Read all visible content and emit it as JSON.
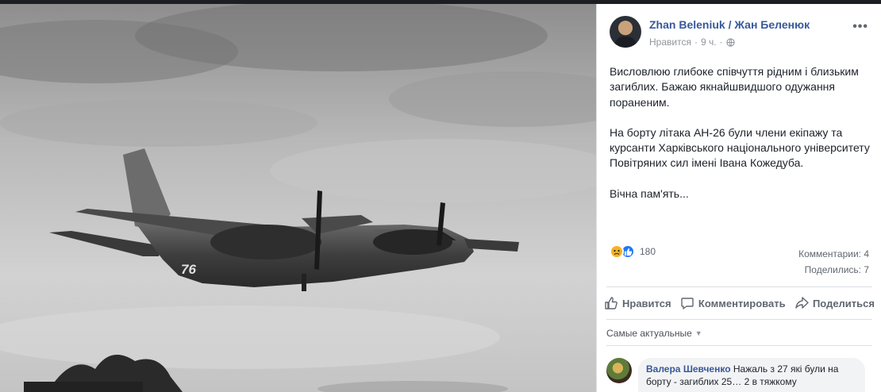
{
  "post": {
    "author": "Zhan Beleniuk / Жан Беленюк",
    "like_link": "Нравится",
    "separator": "·",
    "time": "9 ч.",
    "separator2": "·",
    "more": "•••",
    "paragraphs": [
      "Висловлюю глибоке співчуття рідним і близьким загиблих. Бажаю якнайшвидшого одужання пораненим.",
      "На борту літака АН-26 були члени екіпажу та курсанти Харківського національного університету Повітряних сил імені Івана Кожедуба.",
      "Вічна пам'ять..."
    ]
  },
  "photo": {
    "aircraft_number": "76",
    "icons": [
      "sad-reaction-icon",
      "like-reaction-icon",
      "globe-icon",
      "like-icon",
      "comment-icon",
      "share-icon"
    ]
  },
  "stats": {
    "reaction_count": "180",
    "comments": "Комментарии: 4",
    "shares": "Поделились: 7"
  },
  "actions": {
    "like": "Нравится",
    "comment": "Комментировать",
    "share": "Поделиться"
  },
  "sort": {
    "label": "Самые актуальные",
    "caret": "▼"
  },
  "comment": {
    "name": "Валера Шевченко",
    "text": "Нажаль з 27 які були на борту - загиблих 25… 2 в тяжкому"
  },
  "colors": {
    "link": "#385898",
    "secondary_text": "#606770",
    "like_blue": "#2078f4",
    "sad_yellow": "#f7b125"
  }
}
